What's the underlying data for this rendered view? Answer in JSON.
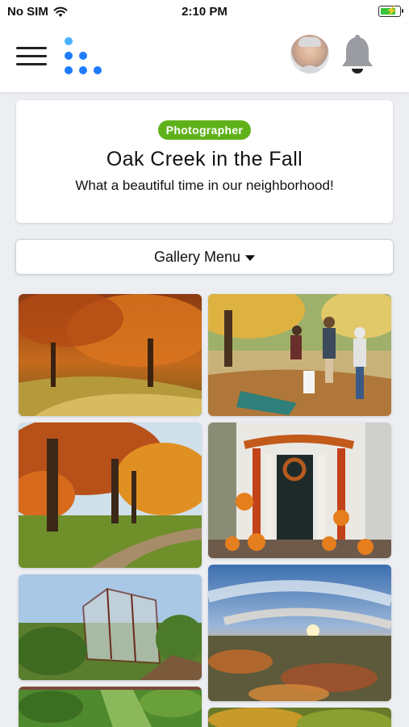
{
  "status_bar": {
    "carrier": "No SIM",
    "time": "2:10 PM",
    "wifi_icon": "wifi-icon",
    "battery_icon": "battery-charging-icon"
  },
  "header": {
    "menu_icon": "hamburger-menu-icon",
    "logo": "dots-logo",
    "avatar": "user-avatar",
    "notification_icon": "bell-icon"
  },
  "gallery": {
    "badge": "Photographer",
    "title": "Oak Creek in the Fall",
    "subtitle": "What a beautiful time in our neighborhood!",
    "menu_label": "Gallery Menu",
    "photos": [
      {
        "subject": "autumn trees over path"
      },
      {
        "subject": "family playing in leaves"
      },
      {
        "subject": "tree-lined park path"
      },
      {
        "subject": "halloween decorated front door"
      },
      {
        "subject": "greenhouse in garden"
      },
      {
        "subject": "sunset over town"
      },
      {
        "subject": "vegetable garden"
      },
      {
        "subject": "autumn foliage"
      }
    ]
  },
  "colors": {
    "badge": "#5fb11a",
    "logo_blue": "#1e7bff",
    "logo_light_blue": "#49b1ff",
    "background": "#eceef2"
  }
}
